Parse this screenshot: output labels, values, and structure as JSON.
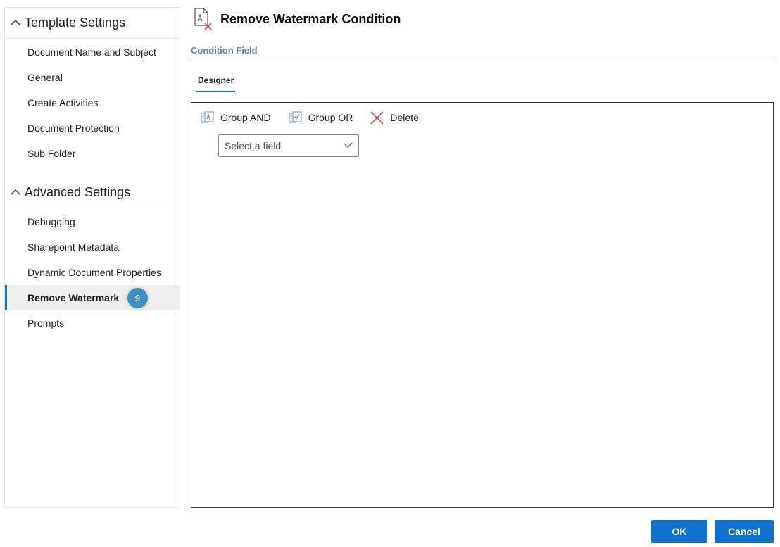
{
  "sidebar": {
    "sections": [
      {
        "title": "Template Settings",
        "items": [
          "Document Name and Subject",
          "General",
          "Create Activities",
          "Document Protection",
          "Sub Folder"
        ]
      },
      {
        "title": "Advanced Settings",
        "items": [
          "Debugging",
          "Sharepoint Metadata",
          "Dynamic Document Properties",
          "Remove Watermark",
          "Prompts"
        ]
      }
    ],
    "active_item": "Remove Watermark",
    "active_badge": "9"
  },
  "header": {
    "title": "Remove Watermark Condition",
    "icon": "document-remove-icon"
  },
  "condition_field": {
    "label": "Condition Field"
  },
  "tabs": {
    "designer": "Designer"
  },
  "toolbar": {
    "group_and": "Group AND",
    "group_or": "Group OR",
    "delete": "Delete"
  },
  "field_select": {
    "placeholder": "Select a field"
  },
  "footer": {
    "ok": "OK",
    "cancel": "Cancel"
  },
  "colors": {
    "accent": "#0f72cf",
    "badge": "#3d8fc0",
    "field_label": "#5b86b8",
    "delete": "#e03a3a"
  }
}
